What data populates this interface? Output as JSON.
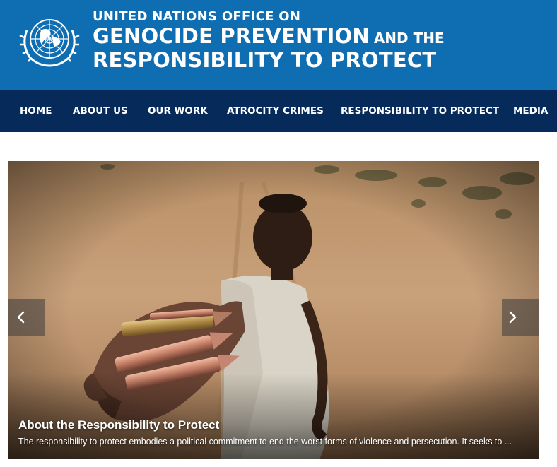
{
  "header": {
    "office_line": "UNITED NATIONS OFFICE ON",
    "title_main": "GENOCIDE PREVENTION",
    "title_connector": "AND THE",
    "title_line3": "RESPONSIBILITY TO PROTECT",
    "brand_color": "#0f6db2"
  },
  "nav": {
    "items": [
      {
        "label": "HOME"
      },
      {
        "label": "ABOUT US"
      },
      {
        "label": "OUR WORK"
      },
      {
        "label": "ATROCITY CRIMES"
      },
      {
        "label": "RESPONSIBILITY TO PROTECT"
      },
      {
        "label": "MEDIA"
      }
    ],
    "bg_color": "#062a5a"
  },
  "slider": {
    "caption_title": "About the Responsibility to Protect",
    "caption_text": "The responsibility to protect embodies a political commitment to end the worst forms of violence and persecution. It seeks to ...",
    "prev_icon": "chevron-left-icon",
    "next_icon": "chevron-right-icon"
  }
}
